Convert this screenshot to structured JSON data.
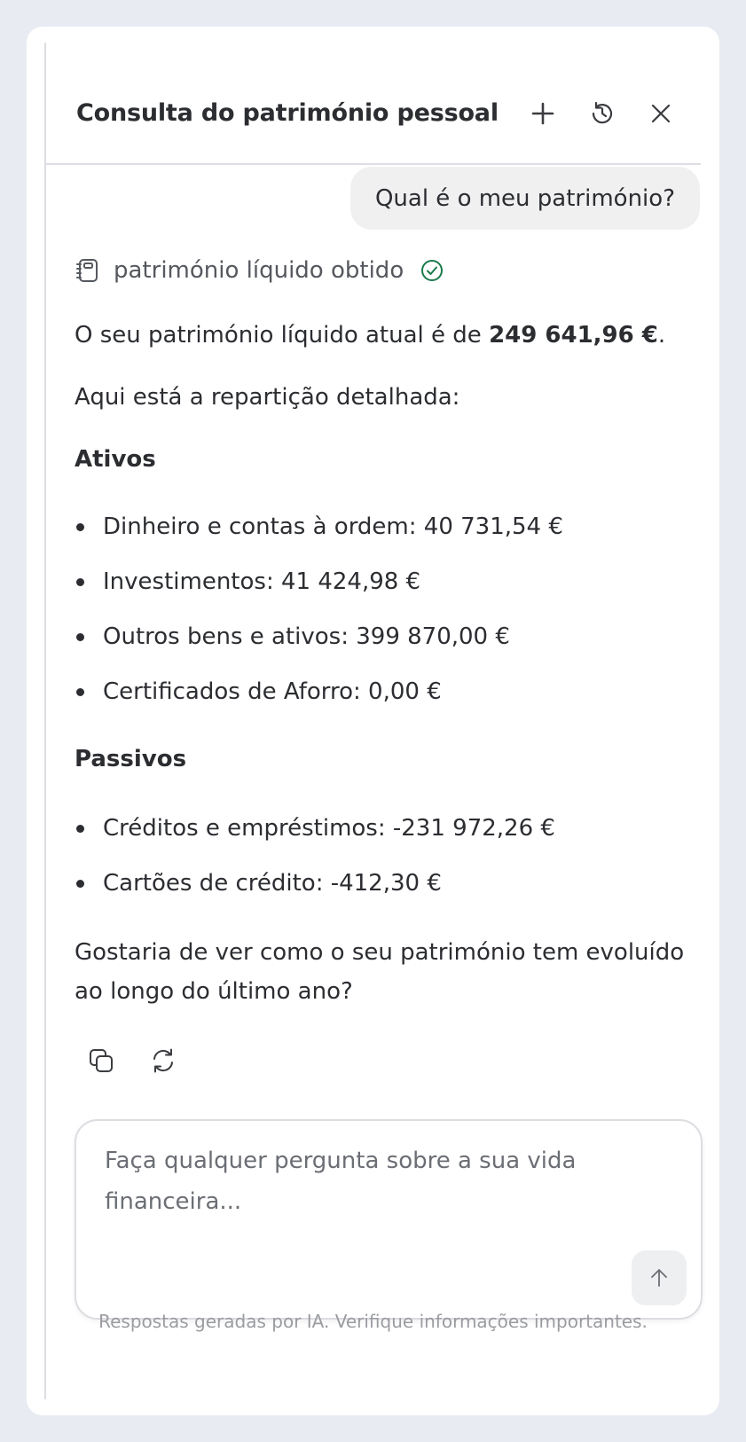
{
  "header": {
    "title": "Consulta do património pessoal"
  },
  "conversation": {
    "user_message": "Qual é o meu património?",
    "tool_status": {
      "label": "património líquido obtido",
      "status_color": "#1a7a4c"
    },
    "reply": {
      "intro_prefix": "O seu património líquido atual é de ",
      "intro_value": "249 641,96 €",
      "intro_suffix": ".",
      "breakdown_intro": "Aqui está a repartição detalhada:",
      "assets_heading": "Ativos",
      "assets": [
        "Dinheiro e contas à ordem: 40 731,54 €",
        "Investimentos: 41 424,98 €",
        "Outros bens e ativos: 399 870,00 €",
        "Certificados de Aforro: 0,00 €"
      ],
      "liabilities_heading": "Passivos",
      "liabilities": [
        "Créditos e empréstimos: -231 972,26 €",
        "Cartões de crédito: -412,30 €"
      ],
      "follow_up": "Gostaria de ver como o seu património tem evoluído ao longo do último ano?"
    }
  },
  "composer": {
    "placeholder": "Faça qualquer pergunta sobre a sua vida financeira..."
  },
  "footer": {
    "disclaimer": "Respostas geradas por IA. Verifique informações importantes."
  },
  "icons": {
    "new_chat": "plus-icon",
    "history": "history-icon",
    "close": "close-icon",
    "tool": "notebook-icon",
    "done": "check-circle-icon",
    "copy": "copy-icon",
    "regenerate": "refresh-icon",
    "send": "arrow-up-icon"
  }
}
